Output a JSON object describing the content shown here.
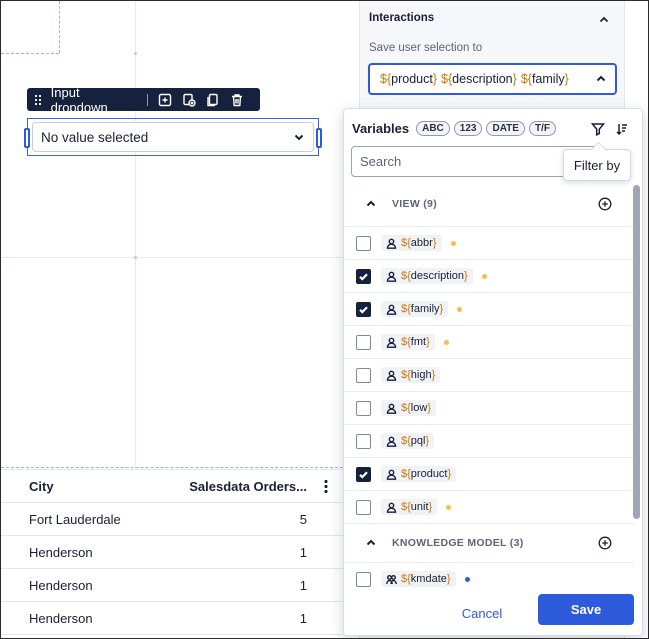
{
  "toolbar": {
    "label": "Input dropdown",
    "icons": [
      "add-component-icon",
      "duplicate-add-icon",
      "copy-icon",
      "trash-icon"
    ]
  },
  "dropdown": {
    "value": "No value selected"
  },
  "table": {
    "columns": [
      "City",
      "Salesdata Orders..."
    ],
    "rows": [
      {
        "city": "Fort Lauderdale",
        "orders": "5"
      },
      {
        "city": "Henderson",
        "orders": "1"
      },
      {
        "city": "Henderson",
        "orders": "1"
      },
      {
        "city": "Henderson",
        "orders": "1"
      }
    ]
  },
  "interactions": {
    "title": "Interactions",
    "save_label": "Save user selection to",
    "selected_tokens": [
      "product",
      "description",
      "family"
    ]
  },
  "variables_popover": {
    "title": "Variables",
    "type_tags": [
      "ABC",
      "123",
      "DATE",
      "T/F"
    ],
    "search_placeholder": "Search",
    "tooltip": "Filter by",
    "groups": [
      {
        "name": "VIEW (9)",
        "items": [
          {
            "name": "abbr",
            "checked": false,
            "dot": "#f5c04a"
          },
          {
            "name": "description",
            "checked": true,
            "dot": "#f5c04a"
          },
          {
            "name": "family",
            "checked": true,
            "dot": "#f5c04a"
          },
          {
            "name": "fmt",
            "checked": false,
            "dot": "#f5c04a"
          },
          {
            "name": "high",
            "checked": false,
            "dot": ""
          },
          {
            "name": "low",
            "checked": false,
            "dot": ""
          },
          {
            "name": "pql",
            "checked": false,
            "dot": ""
          },
          {
            "name": "product",
            "checked": true,
            "dot": ""
          },
          {
            "name": "unit",
            "checked": false,
            "dot": "#f5c04a"
          }
        ]
      },
      {
        "name": "KNOWLEDGE MODEL (3)",
        "items": [
          {
            "name": "kmdate",
            "checked": false,
            "dot": "#2e5bdc"
          }
        ]
      }
    ],
    "cancel_label": "Cancel",
    "save_label": "Save"
  },
  "colors": {
    "accent": "#2e5bdc",
    "toolbar_bg": "#16213e",
    "variable_brace": "#c77a0a"
  }
}
